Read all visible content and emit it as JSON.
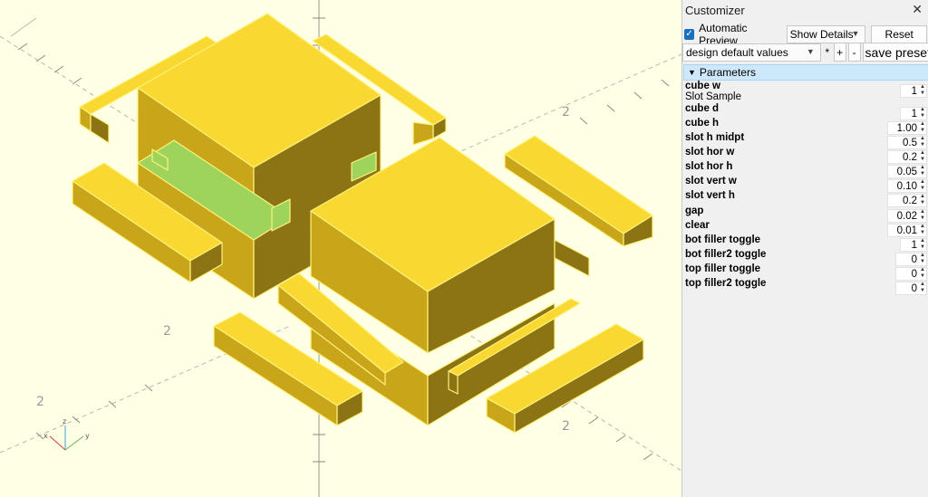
{
  "panel": {
    "title": "Customizer",
    "close_glyph": "✕",
    "automatic_preview_label": "Automatic Preview",
    "automatic_preview_checked": true,
    "details_select_value": "Show Details",
    "reset_label": "Reset",
    "preset_select_value": "design default values",
    "preset_star": "*",
    "preset_add": "+",
    "preset_remove": "-",
    "save_preset_label": "save preset",
    "section_title": "Parameters",
    "subtitle": "Slot Sample",
    "params": [
      {
        "label": "cube w",
        "value": "1"
      },
      {
        "label": "cube d",
        "value": "1"
      },
      {
        "label": "cube h",
        "value": "1.00"
      },
      {
        "label": "slot h midpt",
        "value": "0.5"
      },
      {
        "label": "slot hor w",
        "value": "0.2"
      },
      {
        "label": "slot hor h",
        "value": "0.05"
      },
      {
        "label": "slot vert w",
        "value": "0.10"
      },
      {
        "label": "slot vert h",
        "value": "0.2"
      },
      {
        "label": "gap",
        "value": "0.02"
      },
      {
        "label": "clear",
        "value": "0.01"
      },
      {
        "label": "bot filler toggle",
        "value": "1"
      },
      {
        "label": "bot filler2 toggle",
        "value": "0"
      },
      {
        "label": "top filler toggle",
        "value": "0"
      },
      {
        "label": "top filler2 toggle",
        "value": "0"
      }
    ]
  },
  "viewport": {
    "axis_labels": [
      "2",
      "2",
      "2",
      "2"
    ],
    "gizmo_labels": [
      "z",
      "y",
      "x"
    ],
    "colors": {
      "background": "#ffffe5",
      "part_top": "#f9d831",
      "part_left": "#c9a51a",
      "part_right": "#8c7414",
      "highlight": "#9ed35c",
      "edge": "#fff27a"
    }
  }
}
